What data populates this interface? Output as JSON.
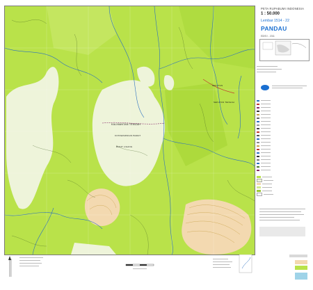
{
  "sheet": {
    "series_title": "PETA RUPABUMI INDONESIA",
    "scale": "1 : 50.000",
    "sheet_number": "Lembar 1514 - 22",
    "sheet_name": "PANDAU",
    "edition": "EDISI I - 2011"
  },
  "map_labels": {
    "province_1": "KALIMANTAN TENGAH",
    "province_2": "KOTAWARINGIN BARAT",
    "place_1": "SEKUTAN",
    "place_2": "SEKUTAN TENGAH",
    "place_3": "BUKIT LIGANG"
  },
  "colors": {
    "forest": "#b9e24a",
    "clearing": "#eef4da",
    "river": "#2a6fc0",
    "contour": "#c9a24a",
    "road": "#c0392b",
    "accent": "#1a6fd1"
  },
  "icons": {
    "agency_logo": "logo-icon",
    "north_arrow": "north-arrow-icon"
  }
}
